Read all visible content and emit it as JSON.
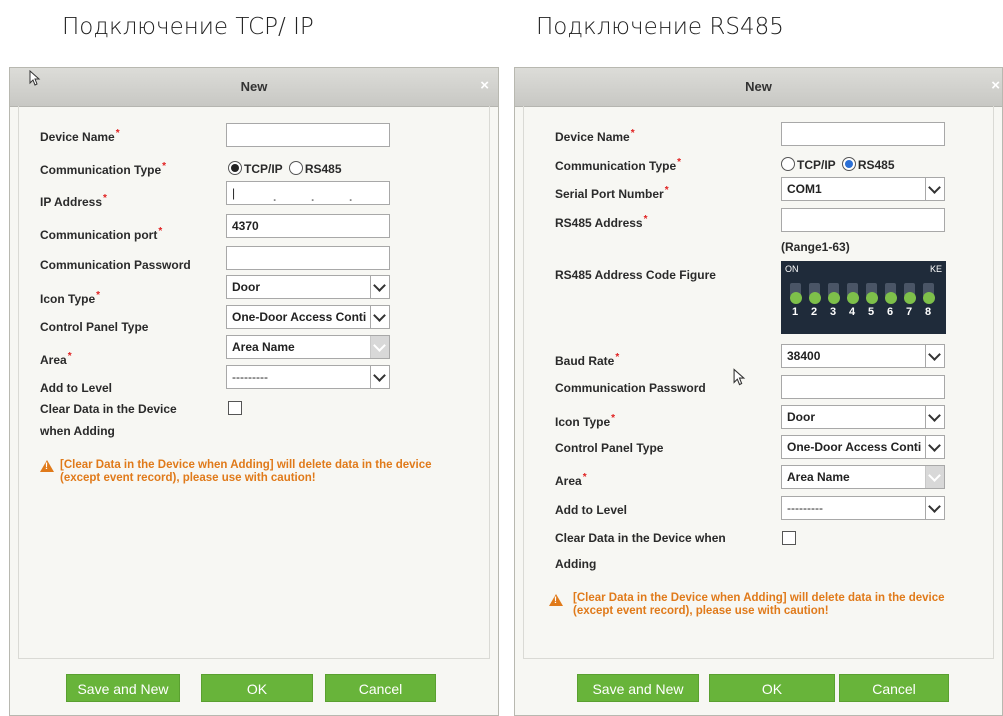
{
  "sections": {
    "left_heading": "Подключение TCP/ IP",
    "right_heading": "Подключение RS485"
  },
  "tcp_dialog": {
    "title": "New",
    "close": "×",
    "labels": {
      "device_name": "Device Name",
      "comm_type": "Communication Type",
      "ip_address": "IP Address",
      "comm_port": "Communication port",
      "comm_password": "Communication Password",
      "icon_type": "Icon Type",
      "panel_type": "Control Panel Type",
      "area": "Area",
      "add_level": "Add to Level",
      "clear_data_1": "Clear Data in the Device",
      "clear_data_2": "when Adding"
    },
    "radio_tcp": "TCP/IP",
    "radio_rs485": "RS485",
    "selected_comm": "TCP/IP",
    "values": {
      "device_name": "",
      "ip_address": "|",
      "comm_port": "4370",
      "comm_password": "",
      "icon_type": "Door",
      "panel_type": "One-Door Access Conti",
      "area": "Area Name",
      "add_level": "---------"
    },
    "warning_1": "[Clear Data in the Device when Adding] will delete data in the device",
    "warning_2": "(except event record), please use with caution!",
    "buttons": {
      "save_new": "Save and New",
      "ok": "OK",
      "cancel": "Cancel"
    }
  },
  "rs_dialog": {
    "title": "New",
    "close": "×",
    "labels": {
      "device_name": "Device Name",
      "comm_type": "Communication Type",
      "serial_port": "Serial Port Number",
      "rs485_address": "RS485 Address",
      "range_hint": "(Range1-63)",
      "code_figure": "RS485 Address Code Figure",
      "baud_rate": "Baud Rate",
      "comm_password": "Communication Password",
      "icon_type": "Icon Type",
      "panel_type": "Control Panel Type",
      "area": "Area",
      "add_level": "Add to Level",
      "clear_data_1": "Clear Data in the Device when",
      "clear_data_2": "Adding"
    },
    "radio_tcp": "TCP/IP",
    "radio_rs485": "RS485",
    "selected_comm": "RS485",
    "values": {
      "device_name": "",
      "serial_port": "COM1",
      "rs485_address": "",
      "baud_rate": "38400",
      "comm_password": "",
      "icon_type": "Door",
      "panel_type": "One-Door Access Conti",
      "area": "Area Name",
      "add_level": "---------"
    },
    "dip_switch": {
      "on_label": "ON",
      "ke_label": "KE",
      "numbers": [
        "1",
        "2",
        "3",
        "4",
        "5",
        "6",
        "7",
        "8"
      ]
    },
    "warning_1": "[Clear Data in the Device when Adding] will delete data in the device",
    "warning_2": "(except event record), please use with caution!",
    "buttons": {
      "save_new": "Save and New",
      "ok": "OK",
      "cancel": "Cancel"
    }
  },
  "colors": {
    "button_green": "#68b43a",
    "warning_orange": "#e07a1a",
    "required_red": "#e02020"
  }
}
